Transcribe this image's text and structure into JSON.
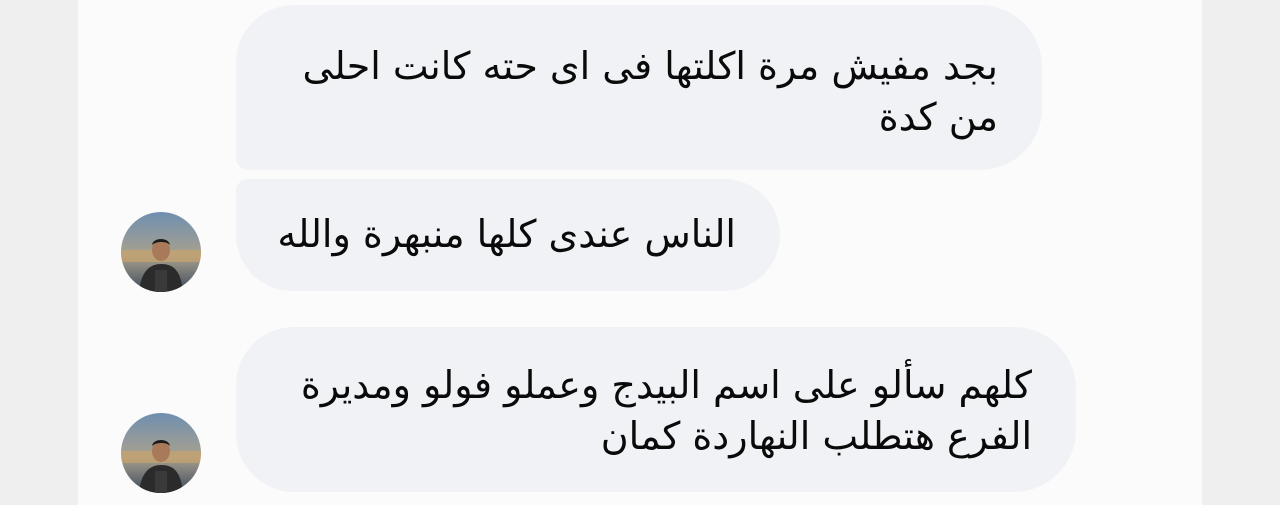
{
  "messages": [
    {
      "lines": [
        "بجد مفيش مرة اكلتها فى اى حته كانت احلى",
        "من كدة"
      ]
    },
    {
      "lines": [
        "الناس عندى كلها منبهرة والله"
      ]
    },
    {
      "lines": [
        "كلهم سألو على اسم البيدج وعملو فولو ومديرة",
        "الفرع هتطلب النهاردة كمان"
      ]
    }
  ],
  "colors": {
    "bubble": "#f0f2f5",
    "panel": "#fbfbfb",
    "page": "#efefef",
    "text": "#0a0a0a"
  },
  "icons": {
    "avatar": "avatar-photo-icon"
  }
}
